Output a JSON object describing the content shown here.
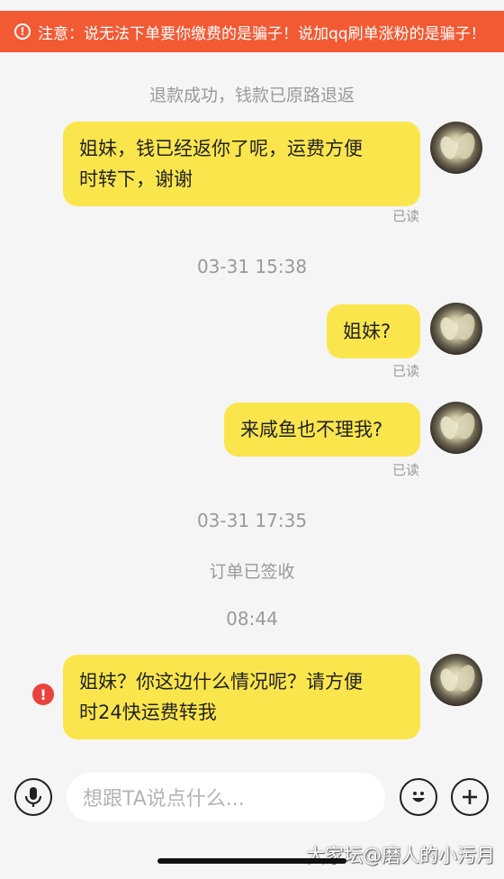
{
  "warning_banner": {
    "icon": "alert-circle-icon",
    "text": "注意：说无法下单要你缴费的是骗子！说加qq刷单涨粉的是骗子！"
  },
  "messages": [
    {
      "type": "system",
      "text": "退款成功，钱款已原路退返"
    },
    {
      "type": "bubble",
      "side": "right",
      "lines": [
        "姐妹，钱已经返你了呢，运费方便",
        "时转下，谢谢"
      ],
      "status": "已读"
    },
    {
      "type": "time",
      "text": "03-31 15:38"
    },
    {
      "type": "bubble",
      "side": "right",
      "lines": [
        "姐妹?"
      ],
      "status": "已读"
    },
    {
      "type": "bubble",
      "side": "right",
      "lines": [
        "来咸鱼也不理我?"
      ],
      "status": "已读"
    },
    {
      "type": "time",
      "text": "03-31 17:35"
    },
    {
      "type": "system",
      "text": "订单已签收"
    },
    {
      "type": "time",
      "text": "08:44"
    },
    {
      "type": "bubble",
      "side": "right",
      "lines": [
        "姐妹？你这边什么情况呢？请方便",
        "时24快运费转我"
      ],
      "status": "",
      "error_icon": "!"
    }
  ],
  "input_bar": {
    "voice_icon": "microphone-icon",
    "placeholder": "想跟TA说点什么...",
    "emoji_icon": "smiley-icon",
    "plus_icon": "plus-icon"
  },
  "watermark": "大家坛@磨人的小污月",
  "colors": {
    "banner": "#f25a34",
    "bubble": "#fae64c",
    "error": "#e8443d",
    "background": "#f5f5f5"
  }
}
